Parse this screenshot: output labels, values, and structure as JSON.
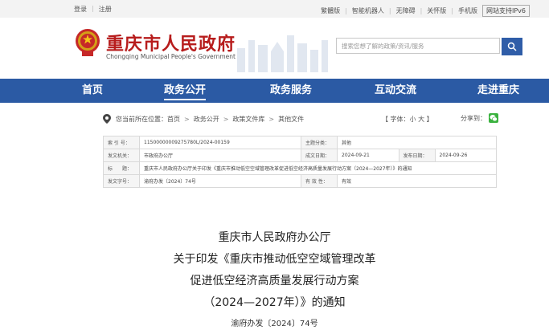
{
  "topbar": {
    "login": "登录",
    "register": "注册",
    "simple_version": "繁體版",
    "robot": "智能机器人",
    "accessibility": "无障碍",
    "care": "关怀版",
    "mobile": "手机版",
    "ipv6": "网站支持IPv6"
  },
  "header": {
    "title_cn": "重庆市人民政府",
    "title_en": "Chongqing Municipal People's Government",
    "search_placeholder": "搜索您想了解的政策/资讯/服务",
    "search_icon": "search-icon"
  },
  "nav": {
    "items": [
      "首页",
      "政务公开",
      "政务服务",
      "互动交流",
      "走进重庆"
    ],
    "active_index": 1
  },
  "breadcrumb": {
    "prefix": "您当前所在位置：",
    "items": [
      "首页",
      "政务公开",
      "政策文件库",
      "其他文件"
    ]
  },
  "font_size": {
    "label": "【 字体：",
    "small": "小",
    "large": "大",
    "suffix": " 】"
  },
  "share": {
    "label": "分享到："
  },
  "meta": {
    "index_no_label": "索 引 号：",
    "index_no": "11500000009275780L/2024-00159",
    "subject_label": "主题分类：",
    "subject": "其他",
    "issuer_label": "发文机关：",
    "issuer": "市政府办公厅",
    "date_label": "成文日期：",
    "date": "2024-09-21",
    "publish_label": "发布日期：",
    "publish": "2024-09-26",
    "title_label": "标　　题：",
    "title": "重庆市人民政府办公厅关于印发《重庆市推动低空空域管理改革促进低空经济高质量发展行动方案（2024—2027年）》的通知",
    "doc_no_label": "发文字号：",
    "doc_no": "渝府办发〔2024〕74号",
    "validity_label": "有 效 性：",
    "validity": "有效"
  },
  "document": {
    "line1": "重庆市人民政府办公厅",
    "line2": "关于印发《重庆市推动低空空域管理改革",
    "line3": "促进低空经济高质量发展行动方案",
    "line4": "（2024—2027年）》的通知",
    "doc_no": "渝府办发〔2024〕74号"
  }
}
